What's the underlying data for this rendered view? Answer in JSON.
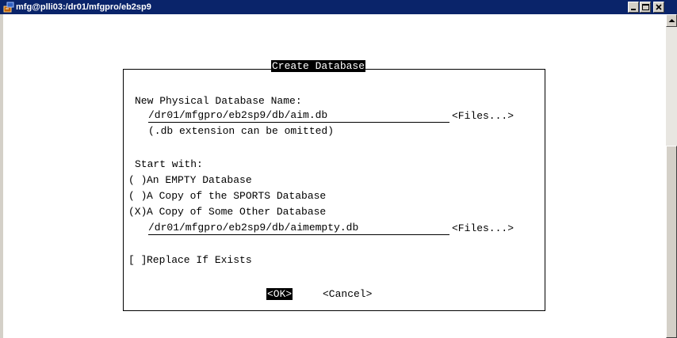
{
  "window": {
    "title": "mfg@plli03:/dr01/mfgpro/eb2sp9"
  },
  "dialog": {
    "title": "Create Database",
    "name_label": "New Physical Database Name:",
    "db_path": "/dr01/mfgpro/eb2sp9/db/aim.db",
    "files_button": "<Files...>",
    "extension_note": "(.db extension can be omitted)",
    "start_label": "Start with:",
    "options": [
      {
        "marker": "( )",
        "label": "An EMPTY Database"
      },
      {
        "marker": "( )",
        "label": "A Copy of the SPORTS Database"
      },
      {
        "marker": "(X)",
        "label": "A Copy of Some Other Database"
      }
    ],
    "copy_path": "/dr01/mfgpro/eb2sp9/db/aimempty.db",
    "replace_marker": "[ ]",
    "replace_label": "Replace If Exists",
    "ok_button": "<OK>",
    "cancel_button": "<Cancel>"
  }
}
